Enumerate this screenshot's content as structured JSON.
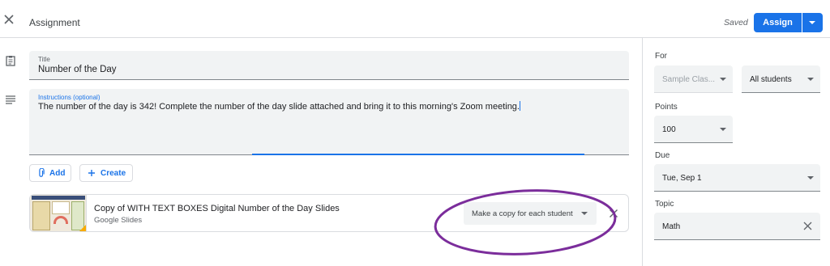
{
  "header": {
    "title": "Assignment",
    "saved_label": "Saved",
    "assign_label": "Assign",
    "close_icon": "close-icon",
    "dropdown_icon": "chevron-down-icon",
    "accent_color": "#1a73e8"
  },
  "main": {
    "title_field": {
      "label": "Title",
      "value": "Number of the Day"
    },
    "instructions_field": {
      "label": "Instructions (optional)",
      "value": "The number of the day is 342! Complete the number of the day slide attached and bring it to this morning's Zoom meeting."
    },
    "add_button": {
      "label": "Add",
      "icon": "paperclip-icon"
    },
    "create_button": {
      "label": "Create",
      "icon": "plus-icon"
    },
    "attachment": {
      "title": "Copy of WITH TEXT BOXES Digital Number of the Day Slides",
      "subtitle": "Google Slides",
      "copy_option": "Make a copy for each student",
      "remove_icon": "close-icon"
    },
    "annotation_color": "#7b2d9b"
  },
  "sidebar": {
    "for_label": "For",
    "class_value": "Sample Clas...",
    "students_value": "All students",
    "points_label": "Points",
    "points_value": "100",
    "due_label": "Due",
    "due_value": "Tue, Sep 1",
    "topic_label": "Topic",
    "topic_value": "Math"
  }
}
